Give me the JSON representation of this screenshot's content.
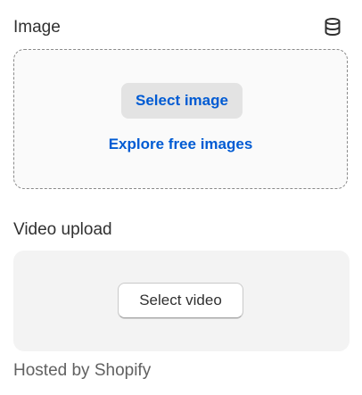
{
  "image_section": {
    "label": "Image",
    "icon": "database-icon",
    "select_button_label": "Select image",
    "explore_link_label": "Explore free images",
    "accent_color": "#005bd3"
  },
  "video_section": {
    "label": "Video upload",
    "select_button_label": "Select video",
    "hosted_note": "Hosted by Shopify"
  }
}
